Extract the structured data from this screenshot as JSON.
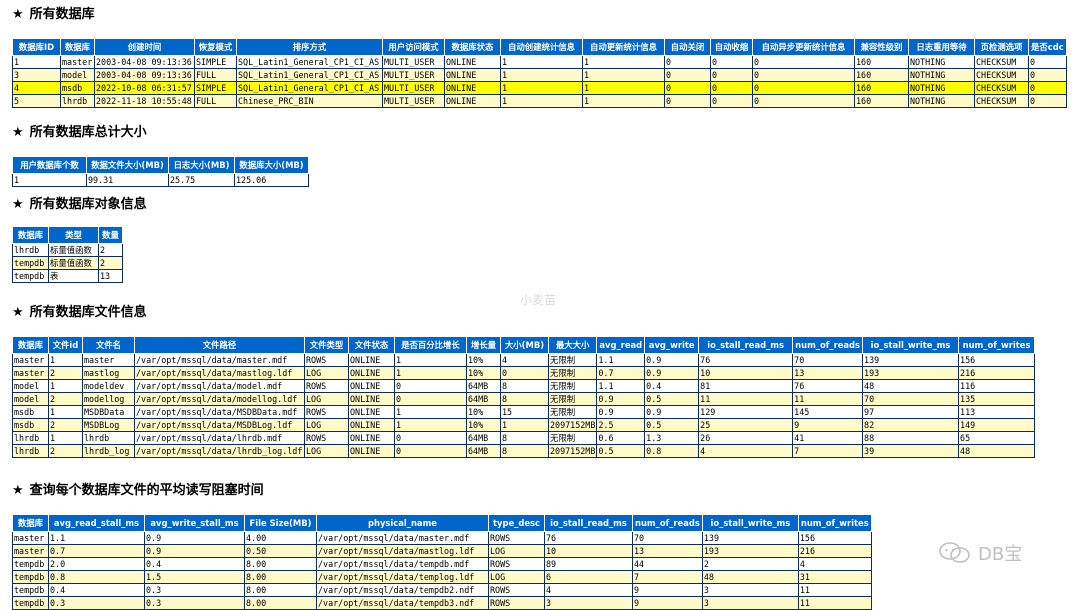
{
  "sections": [
    {
      "star": "★",
      "title": "所有数据库",
      "headers": [
        "数据库ID",
        "数据库",
        "创建时间",
        "恢复模式",
        "排序方式",
        "用户访问模式",
        "数据库状态",
        "自动创建统计信息",
        "自动更新统计信息",
        "自动关闭",
        "自动收缩",
        "自动异步更新统计信息",
        "兼容性级别",
        "日志重用等待",
        "页检测选项",
        "是否cdc"
      ],
      "rows": [
        [
          "1",
          "master",
          "2003-04-08 09:13:36",
          "SIMPLE",
          "SQL_Latin1_General_CP1_CI_AS",
          "MULTI_USER",
          "ONLINE",
          "1",
          "1",
          "0",
          "0",
          "0",
          "160",
          "NOTHING",
          "CHECKSUM",
          "0"
        ],
        [
          "3",
          "model",
          "2003-04-08 09:13:36",
          "FULL",
          "SQL_Latin1_General_CP1_CI_AS",
          "MULTI_USER",
          "ONLINE",
          "1",
          "1",
          "0",
          "0",
          "0",
          "160",
          "NOTHING",
          "CHECKSUM",
          "0"
        ],
        [
          "4",
          "msdb",
          "2022-10-08 06:31:57",
          "SIMPLE",
          "SQL_Latin1_General_CP1_CI_AS",
          "MULTI_USER",
          "ONLINE",
          "1",
          "1",
          "0",
          "0",
          "0",
          "160",
          "NOTHING",
          "CHECKSUM",
          "0"
        ],
        [
          "5",
          "lhrdb",
          "2022-11-18 10:55:48",
          "FULL",
          "Chinese_PRC_BIN",
          "MULTI_USER",
          "ONLINE",
          "1",
          "1",
          "0",
          "0",
          "0",
          "160",
          "NOTHING",
          "CHECKSUM",
          "0"
        ]
      ],
      "highlight_row": 2
    },
    {
      "star": "★",
      "title": "所有数据库总计大小",
      "headers": [
        "用户数据库个数",
        "数据文件大小(MB)",
        "日志大小(MB)",
        "数据库大小(MB)"
      ],
      "rows": [
        [
          "1",
          "99.31",
          "25.75",
          "125.06"
        ]
      ]
    },
    {
      "star": "★",
      "title": "所有数据库对象信息",
      "headers": [
        "数据库",
        "类型",
        "数量"
      ],
      "rows": [
        [
          "lhrdb",
          "标量值函数",
          "2"
        ],
        [
          "tempdb",
          "标量值函数",
          "2"
        ],
        [
          "tempdb",
          "表",
          "13"
        ]
      ]
    },
    {
      "star": "★",
      "title": "所有数据库文件信息",
      "headers": [
        "数据库",
        "文件id",
        "文件名",
        "文件路径",
        "文件类型",
        "文件状态",
        "是否百分比增长",
        "增长量",
        "大小(MB)",
        "最大大小",
        "avg_read",
        "avg_write",
        "io_stall_read_ms",
        "num_of_reads",
        "io_stall_write_ms",
        "num_of_writes"
      ],
      "rows": [
        [
          "master",
          "1",
          "master",
          "/var/opt/mssql/data/master.mdf",
          "ROWS",
          "ONLINE",
          "1",
          "10%",
          "4",
          "无限制",
          "1.1",
          "0.9",
          "76",
          "70",
          "139",
          "156"
        ],
        [
          "master",
          "2",
          "mastlog",
          "/var/opt/mssql/data/mastlog.ldf",
          "LOG",
          "ONLINE",
          "1",
          "10%",
          "0",
          "无限制",
          "0.7",
          "0.9",
          "10",
          "13",
          "193",
          "216"
        ],
        [
          "model",
          "1",
          "modeldev",
          "/var/opt/mssql/data/model.mdf",
          "ROWS",
          "ONLINE",
          "0",
          "64MB",
          "8",
          "无限制",
          "1.1",
          "0.4",
          "81",
          "76",
          "48",
          "116"
        ],
        [
          "model",
          "2",
          "modellog",
          "/var/opt/mssql/data/modellog.ldf",
          "LOG",
          "ONLINE",
          "0",
          "64MB",
          "8",
          "无限制",
          "0.9",
          "0.5",
          "11",
          "11",
          "70",
          "135"
        ],
        [
          "msdb",
          "1",
          "MSDBData",
          "/var/opt/mssql/data/MSDBData.mdf",
          "ROWS",
          "ONLINE",
          "1",
          "10%",
          "15",
          "无限制",
          "0.9",
          "0.9",
          "129",
          "145",
          "97",
          "113"
        ],
        [
          "msdb",
          "2",
          "MSDBLog",
          "/var/opt/mssql/data/MSDBLog.ldf",
          "LOG",
          "ONLINE",
          "1",
          "10%",
          "1",
          "2097152MB",
          "2.5",
          "0.5",
          "25",
          "9",
          "82",
          "149"
        ],
        [
          "lhrdb",
          "1",
          "lhrdb",
          "/var/opt/mssql/data/lhrdb.mdf",
          "ROWS",
          "ONLINE",
          "0",
          "64MB",
          "8",
          "无限制",
          "0.6",
          "1.3",
          "26",
          "41",
          "88",
          "65"
        ],
        [
          "lhrdb",
          "2",
          "lhrdb_log",
          "/var/opt/mssql/data/lhrdb_log.ldf",
          "LOG",
          "ONLINE",
          "0",
          "64MB",
          "8",
          "2097152MB",
          "0.5",
          "0.8",
          "4",
          "7",
          "39",
          "48"
        ]
      ]
    },
    {
      "star": "★",
      "title": "查询每个数据库文件的平均读写阻塞时间",
      "headers": [
        "数据库",
        "avg_read_stall_ms",
        "avg_write_stall_ms",
        "File Size(MB)",
        "physical_name",
        "type_desc",
        "io_stall_read_ms",
        "num_of_reads",
        "io_stall_write_ms",
        "num_of_writes"
      ],
      "rows": [
        [
          "master",
          "1.1",
          "0.9",
          "4.00",
          "/var/opt/mssql/data/master.mdf",
          "ROWS",
          "76",
          "70",
          "139",
          "156"
        ],
        [
          "master",
          "0.7",
          "0.9",
          "0.50",
          "/var/opt/mssql/data/mastlog.ldf",
          "LOG",
          "10",
          "13",
          "193",
          "216"
        ],
        [
          "tempdb",
          "2.0",
          "0.4",
          "8.00",
          "/var/opt/mssql/data/tempdb.mdf",
          "ROWS",
          "89",
          "44",
          "2",
          "4"
        ],
        [
          "tempdb",
          "0.8",
          "1.5",
          "8.00",
          "/var/opt/mssql/data/templog.ldf",
          "LOG",
          "6",
          "7",
          "48",
          "31"
        ],
        [
          "tempdb",
          "0.4",
          "0.3",
          "8.00",
          "/var/opt/mssql/data/tempdb2.ndf",
          "ROWS",
          "4",
          "9",
          "3",
          "11"
        ],
        [
          "tempdb",
          "0.3",
          "0.3",
          "8.00",
          "/var/opt/mssql/data/tempdb3.ndf",
          "ROWS",
          "3",
          "9",
          "3",
          "11"
        ]
      ]
    }
  ],
  "watermarks": {
    "center": "小麦苗",
    "logo_text": "DB宝"
  }
}
